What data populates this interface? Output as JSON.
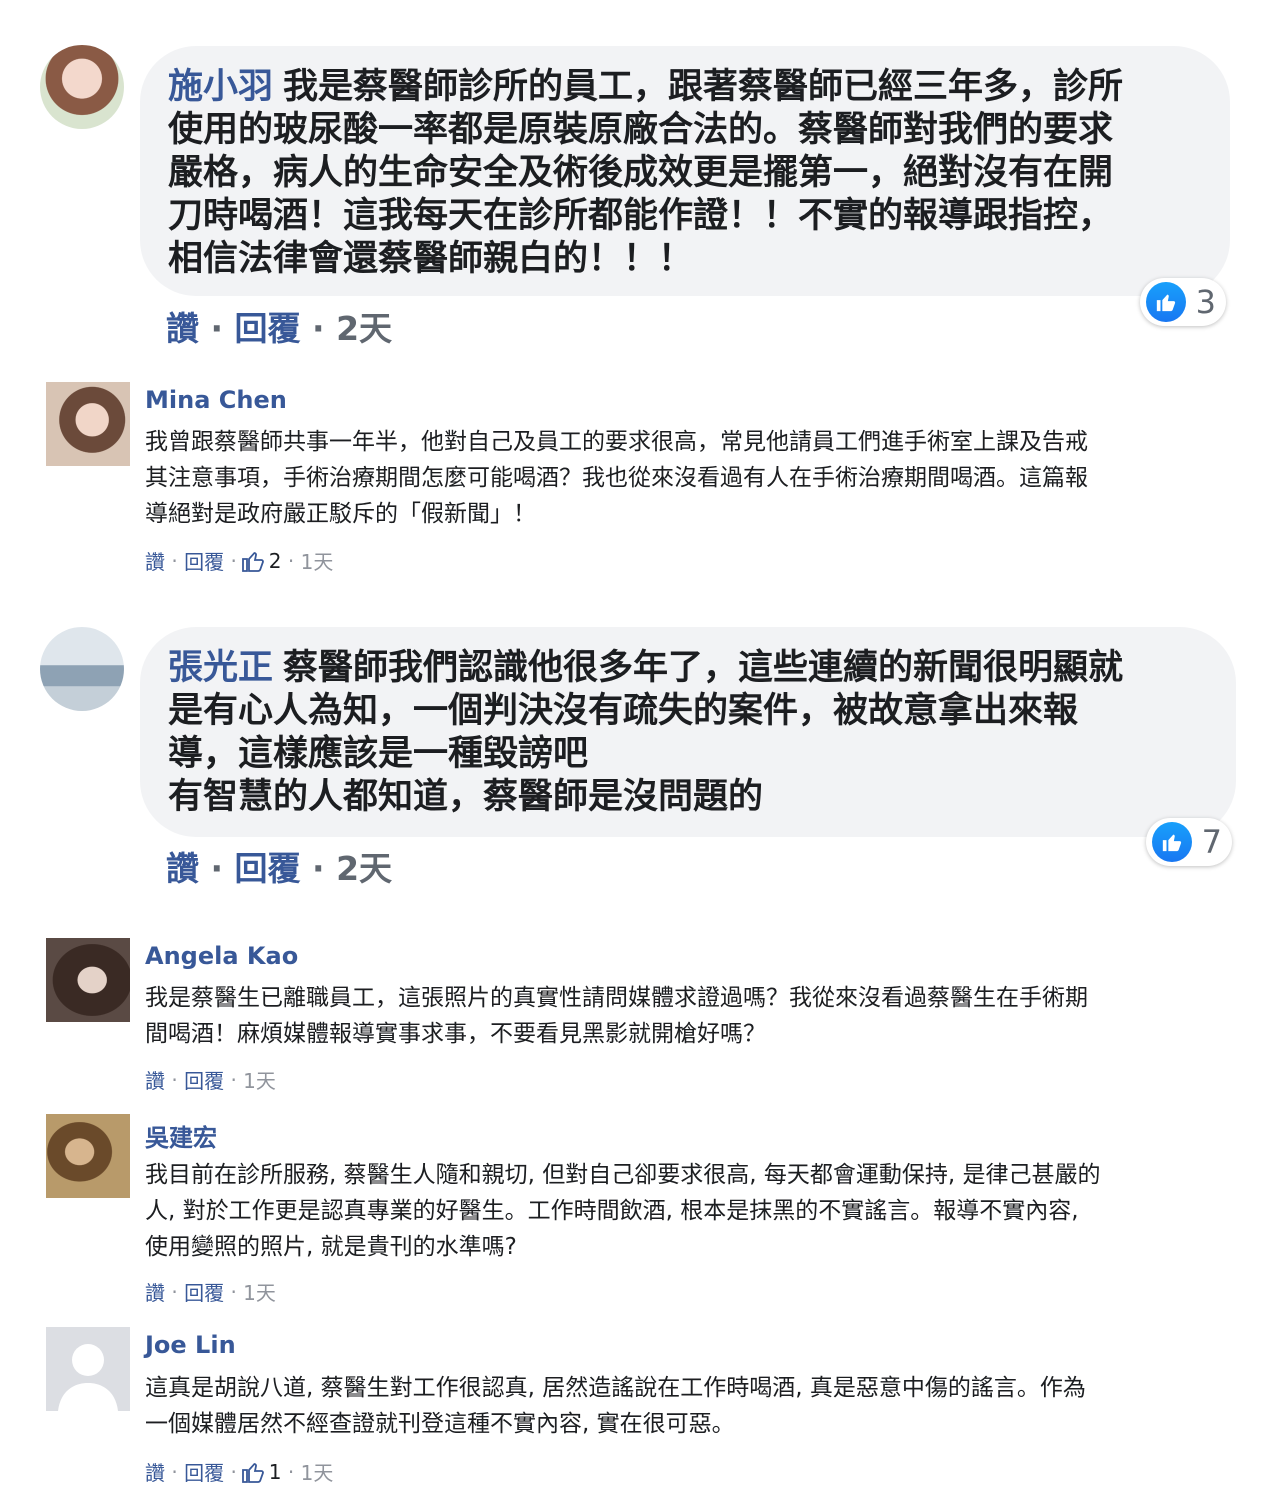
{
  "actions": {
    "like": "讚",
    "reply": "回覆",
    "dot": "·"
  },
  "comments": [
    {
      "author": "施小羽",
      "text": "我是蔡醫師診所的員工，跟著蔡醫師已經三年多，診所\n使用的玻尿酸一率都是原裝原廠合法的。蔡醫師對我們的要求\n嚴格，病人的生命安全及術後成效更是擺第一，絕對沒有在開\n刀時喝酒！這我每天在診所都能作證！！不實的報導跟指控，\n相信法律會還蔡醫師親白的！！！",
      "time": "2天",
      "likes": "3"
    },
    {
      "author": "Mina Chen",
      "text": "我曾跟蔡醫師共事一年半，他對自己及員工的要求很高，常見他請員工們進手術室上課及告戒\n其注意事項，手術治療期間怎麼可能喝酒？我也從來沒看過有人在手術治療期間喝酒。這篇報\n導絕對是政府嚴正駁斥的「假新聞」！",
      "time": "1天",
      "likes": "2"
    },
    {
      "author": "張光正",
      "text": "蔡醫師我們認識他很多年了，這些連續的新聞很明顯就\n是有心人為知，一個判決沒有疏失的案件，被故意拿出來報\n導，這樣應該是一種毀謗吧\n有智慧的人都知道，蔡醫師是沒問題的",
      "time": "2天",
      "likes": "7"
    },
    {
      "author": "Angela Kao",
      "text": "我是蔡醫生已離職員工，這張照片的真實性請問媒體求證過嗎？我從來沒看過蔡醫生在手術期\n間喝酒！麻煩媒體報導實事求事，不要看見黑影就開槍好嗎？",
      "time": "1天"
    },
    {
      "author": "吳建宏",
      "text": "我目前在診所服務, 蔡醫生人隨和親切, 但對自己卻要求很高, 每天都會運動保持, 是律己甚嚴的\n人, 對於工作更是認真專業的好醫生。工作時間飲酒, 根本是抹黑的不實謠言。報導不實內容,\n使用變照的照片, 就是貴刊的水準嗎?",
      "time": "1天"
    },
    {
      "author": "Joe Lin",
      "text": "這真是胡說八道, 蔡醫生對工作很認真, 居然造謠說在工作時喝酒, 真是惡意中傷的謠言。作為\n一個媒體居然不經查證就刊登這種不實內容, 實在很可惡。",
      "time": "1天",
      "likes": "1"
    }
  ],
  "colors": {
    "link": "#385898",
    "bubble": "#f2f3f5",
    "meta": "#90949c",
    "like_blue": "#1877f2"
  },
  "icons": {
    "like": "thumbs-up-icon",
    "like_outline": "thumbs-up-outline-icon"
  }
}
